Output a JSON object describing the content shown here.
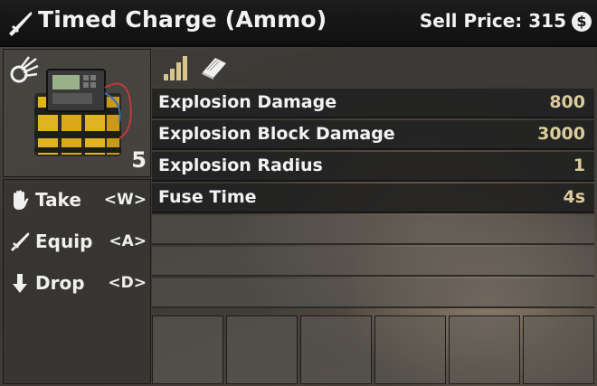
{
  "header": {
    "title": "Timed Charge (Ammo)",
    "sell_price_label": "Sell Price: 315",
    "currency_icon": "coin-icon",
    "currency_symbol": "$",
    "item_icon": "knife-icon"
  },
  "item": {
    "image": "timed-charge-explosive-image",
    "class_icon": "explosion-burst-icon",
    "quantity": "5"
  },
  "actions": [
    {
      "label": "Take",
      "key": "<W>",
      "icon": "hand-icon"
    },
    {
      "label": "Equip",
      "key": "<A>",
      "icon": "knife-icon"
    },
    {
      "label": "Drop",
      "key": "<D>",
      "icon": "arrow-down-icon"
    }
  ],
  "tabs": [
    {
      "icon": "stats-bars-icon"
    },
    {
      "icon": "book-icon"
    }
  ],
  "stats": [
    {
      "label": "Explosion Damage",
      "value": "800"
    },
    {
      "label": "Explosion Block Damage",
      "value": "3000"
    },
    {
      "label": "Explosion Radius",
      "value": "1"
    },
    {
      "label": "Fuse Time",
      "value": "4s"
    }
  ],
  "empty_stat_rows": 3,
  "mod_slots": 6,
  "colors": {
    "title_bar": "#141414",
    "stat_value": "#dccc9c",
    "stat_row": "#222222",
    "text": "#f2f2f2"
  }
}
